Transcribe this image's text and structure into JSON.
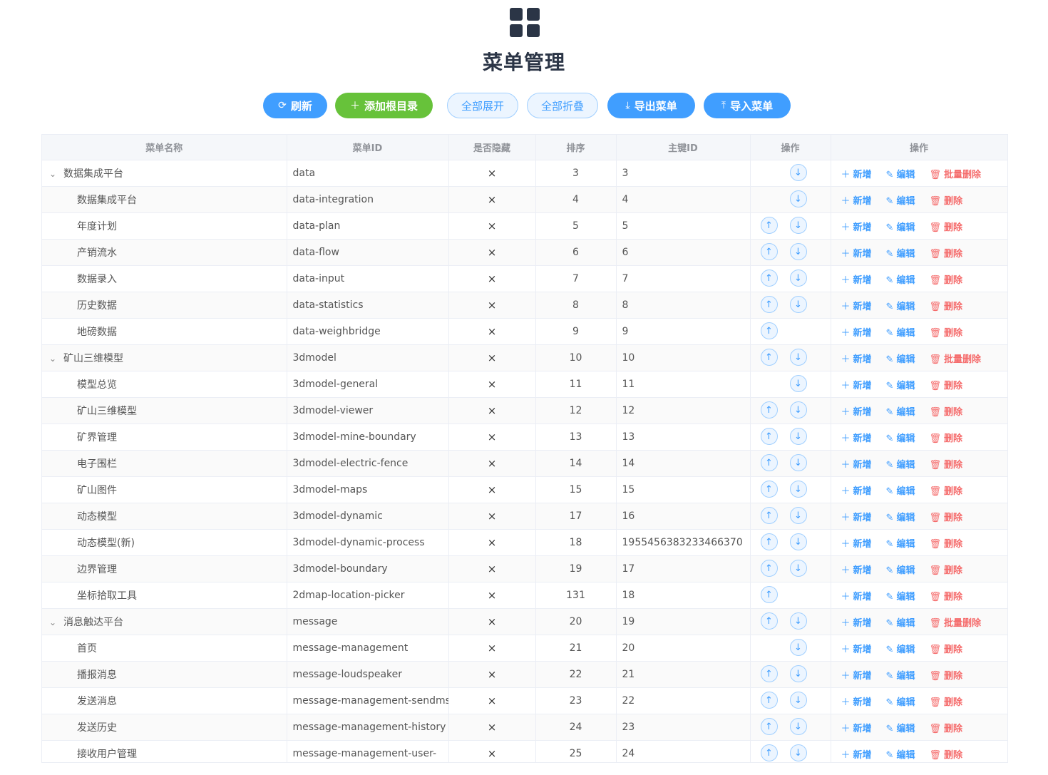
{
  "page": {
    "title": "菜单管理"
  },
  "toolbar": {
    "refresh": "刷新",
    "add_root": "添加根目录",
    "expand_all": "全部展开",
    "collapse_all": "全部折叠",
    "export": "导出菜单",
    "import": "导入菜单"
  },
  "table": {
    "headers": [
      "菜单名称",
      "菜单ID",
      "是否隐藏",
      "排序",
      "主键ID",
      "操作",
      "操作"
    ],
    "actions": {
      "add": "新增",
      "edit": "编辑",
      "delete": "删除",
      "batch_delete": "批量删除"
    },
    "hidden_mark": "×",
    "rows": [
      {
        "name": "数据集成平台",
        "id": "data",
        "sort": "3",
        "pk": "3",
        "parent": true,
        "up": false,
        "down": true
      },
      {
        "name": "数据集成平台",
        "id": "data-integration",
        "sort": "4",
        "pk": "4",
        "parent": false,
        "up": false,
        "down": true
      },
      {
        "name": "年度计划",
        "id": "data-plan",
        "sort": "5",
        "pk": "5",
        "parent": false,
        "up": true,
        "down": true
      },
      {
        "name": "产销流水",
        "id": "data-flow",
        "sort": "6",
        "pk": "6",
        "parent": false,
        "up": true,
        "down": true
      },
      {
        "name": "数据录入",
        "id": "data-input",
        "sort": "7",
        "pk": "7",
        "parent": false,
        "up": true,
        "down": true
      },
      {
        "name": "历史数据",
        "id": "data-statistics",
        "sort": "8",
        "pk": "8",
        "parent": false,
        "up": true,
        "down": true
      },
      {
        "name": "地磅数据",
        "id": "data-weighbridge",
        "sort": "9",
        "pk": "9",
        "parent": false,
        "up": true,
        "down": false
      },
      {
        "name": "矿山三维模型",
        "id": "3dmodel",
        "sort": "10",
        "pk": "10",
        "parent": true,
        "up": true,
        "down": true
      },
      {
        "name": "模型总览",
        "id": "3dmodel-general",
        "sort": "11",
        "pk": "11",
        "parent": false,
        "up": false,
        "down": true
      },
      {
        "name": "矿山三维模型",
        "id": "3dmodel-viewer",
        "sort": "12",
        "pk": "12",
        "parent": false,
        "up": true,
        "down": true
      },
      {
        "name": "矿界管理",
        "id": "3dmodel-mine-boundary",
        "sort": "13",
        "pk": "13",
        "parent": false,
        "up": true,
        "down": true
      },
      {
        "name": "电子围栏",
        "id": "3dmodel-electric-fence",
        "sort": "14",
        "pk": "14",
        "parent": false,
        "up": true,
        "down": true
      },
      {
        "name": "矿山图件",
        "id": "3dmodel-maps",
        "sort": "15",
        "pk": "15",
        "parent": false,
        "up": true,
        "down": true
      },
      {
        "name": "动态模型",
        "id": "3dmodel-dynamic",
        "sort": "17",
        "pk": "16",
        "parent": false,
        "up": true,
        "down": true
      },
      {
        "name": "动态模型(新)",
        "id": "3dmodel-dynamic-process",
        "sort": "18",
        "pk": "1955456383233466370",
        "parent": false,
        "up": true,
        "down": true
      },
      {
        "name": "边界管理",
        "id": "3dmodel-boundary",
        "sort": "19",
        "pk": "17",
        "parent": false,
        "up": true,
        "down": true
      },
      {
        "name": "坐标拾取工具",
        "id": "2dmap-location-picker",
        "sort": "131",
        "pk": "18",
        "parent": false,
        "up": true,
        "down": false
      },
      {
        "name": "消息触达平台",
        "id": "message",
        "sort": "20",
        "pk": "19",
        "parent": true,
        "up": true,
        "down": true
      },
      {
        "name": "首页",
        "id": "message-management",
        "sort": "21",
        "pk": "20",
        "parent": false,
        "up": false,
        "down": true
      },
      {
        "name": "播报消息",
        "id": "message-loudspeaker",
        "sort": "22",
        "pk": "21",
        "parent": false,
        "up": true,
        "down": true
      },
      {
        "name": "发送消息",
        "id": "message-management-sendmsg",
        "sort": "23",
        "pk": "22",
        "parent": false,
        "up": true,
        "down": true
      },
      {
        "name": "发送历史",
        "id": "message-management-history",
        "sort": "24",
        "pk": "23",
        "parent": false,
        "up": true,
        "down": true
      },
      {
        "name": "接收用户管理",
        "id": "message-management-user-",
        "sort": "25",
        "pk": "24",
        "parent": false,
        "up": true,
        "down": true
      }
    ]
  }
}
